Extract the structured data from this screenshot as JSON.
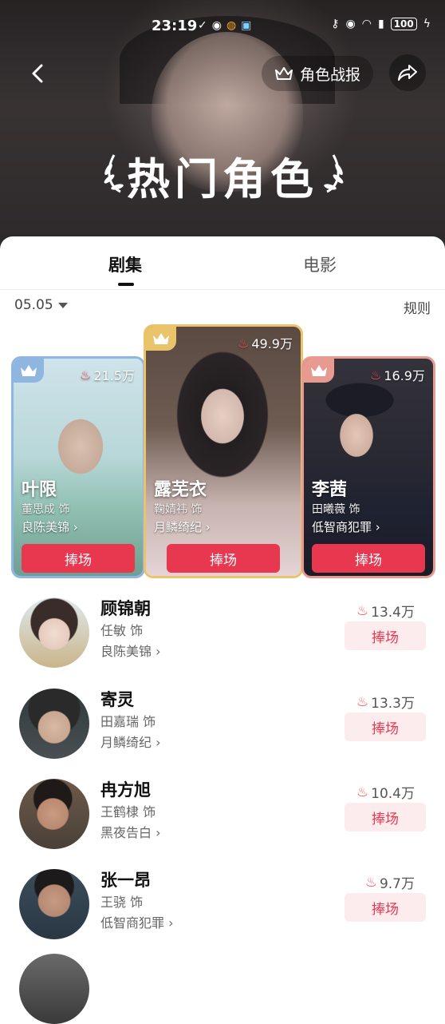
{
  "status_bar": {
    "time": "23:19",
    "battery": "100"
  },
  "header": {
    "report_label": "角色战报",
    "title": "热门角色"
  },
  "tabs": [
    {
      "label": "剧集",
      "active": true
    },
    {
      "label": "电影",
      "active": false
    }
  ],
  "filter": {
    "date": "05.05",
    "rules_label": "规则"
  },
  "colors": {
    "accent": "#e8384f",
    "accent_light": "#fdecee",
    "gold": "#e9c46a",
    "blue": "#8fb6e0",
    "pink": "#e79a8f"
  },
  "top_cards": [
    {
      "rank_color": "blue",
      "hot": "21.5万",
      "name": "叶限",
      "actor": "董思成 饰",
      "show": "良陈美锦",
      "button": "捧场"
    },
    {
      "rank_color": "gold",
      "hot": "49.9万",
      "name": "露芜衣",
      "actor": "鞠婧祎 饰",
      "show": "月鳞绮纪",
      "button": "捧场"
    },
    {
      "rank_color": "pink",
      "hot": "16.9万",
      "name": "李茜",
      "actor": "田曦薇 饰",
      "show": "低智商犯罪",
      "button": "捧场"
    }
  ],
  "list": [
    {
      "name": "顾锦朝",
      "actor": "任敏 饰",
      "show": "良陈美锦",
      "hot": "13.4万",
      "button": "捧场"
    },
    {
      "name": "寄灵",
      "actor": "田嘉瑞 饰",
      "show": "月鳞绮纪",
      "hot": "13.3万",
      "button": "捧场"
    },
    {
      "name": "冉方旭",
      "actor": "王鹤棣 饰",
      "show": "黑夜告白",
      "hot": "10.4万",
      "button": "捧场"
    },
    {
      "name": "张一昂",
      "actor": "王骁 饰",
      "show": "低智商犯罪",
      "hot": "9.7万",
      "button": "捧场"
    }
  ]
}
